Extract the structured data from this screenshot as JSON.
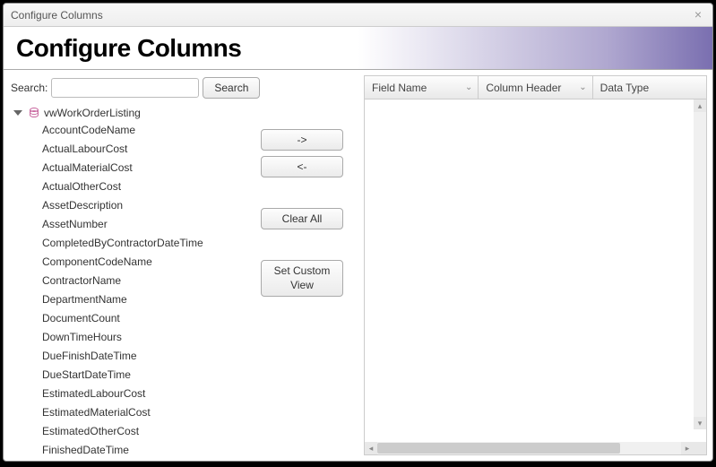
{
  "window": {
    "title": "Configure Columns"
  },
  "header": {
    "title": "Configure Columns"
  },
  "search": {
    "label": "Search:",
    "value": "",
    "button": "Search"
  },
  "tree": {
    "root": "vwWorkOrderListing",
    "items": [
      "AccountCodeName",
      "ActualLabourCost",
      "ActualMaterialCost",
      "ActualOtherCost",
      "AssetDescription",
      "AssetNumber",
      "CompletedByContractorDateTime",
      "ComponentCodeName",
      "ContractorName",
      "DepartmentName",
      "DocumentCount",
      "DownTimeHours",
      "DueFinishDateTime",
      "DueStartDateTime",
      "EstimatedLabourCost",
      "EstimatedMaterialCost",
      "EstimatedOtherCost",
      "FinishedDateTime"
    ]
  },
  "buttons": {
    "add": "->",
    "remove": "<-",
    "clear": "Clear All",
    "custom": "Set Custom View"
  },
  "grid": {
    "columns": [
      "Field Name",
      "Column Header",
      "Data Type"
    ]
  }
}
